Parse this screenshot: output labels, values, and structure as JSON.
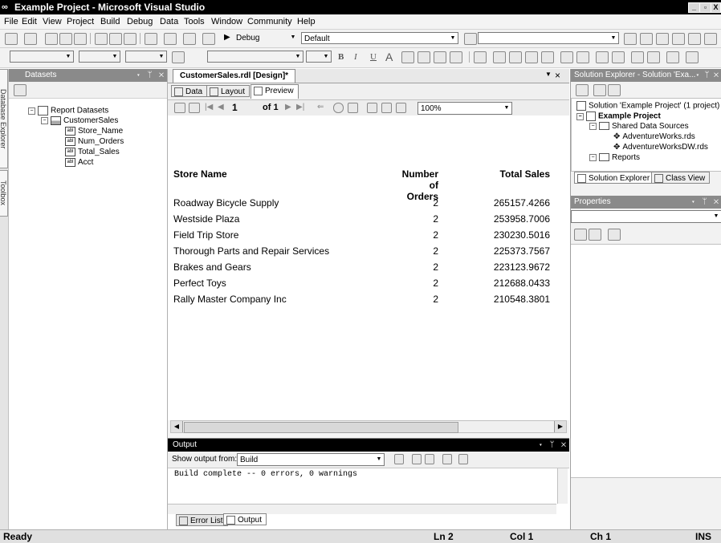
{
  "window": {
    "title": "Example Project - Microsoft Visual Studio",
    "min": "_",
    "max": "▫",
    "close": "X"
  },
  "menu": [
    "File",
    "Edit",
    "View",
    "Project",
    "Build",
    "Debug",
    "Data",
    "Tools",
    "Window",
    "Community",
    "Help"
  ],
  "toolbar": {
    "config": "Debug",
    "platform": "Default"
  },
  "left_tabs": {
    "db_explorer": "Database Explorer",
    "toolbox": "Toolbox"
  },
  "datasets": {
    "title": "Datasets",
    "root": "Report Datasets",
    "dataset": "CustomerSales",
    "fields": [
      "Store_Name",
      "Num_Orders",
      "Total_Sales",
      "Acct"
    ],
    "field_badge": "abl"
  },
  "doc": {
    "tab": "CustomerSales.rdl [Design]*",
    "close": "×",
    "subtabs": [
      "Data",
      "Layout",
      "Preview"
    ],
    "preview_toolbar": {
      "page": "1",
      "of": "of 1",
      "zoom": "100%"
    }
  },
  "report": {
    "headers": {
      "store": "Store Name",
      "orders_1": "Number of",
      "orders_2": "Orders",
      "sales": "Total Sales"
    },
    "rows": [
      {
        "store": "Roadway Bicycle Supply",
        "orders": "2",
        "sales": "265157.4266"
      },
      {
        "store": "Westside Plaza",
        "orders": "2",
        "sales": "253958.7006"
      },
      {
        "store": "Field Trip Store",
        "orders": "2",
        "sales": "230230.5016"
      },
      {
        "store": "Thorough Parts and Repair Services",
        "orders": "2",
        "sales": "225373.7567"
      },
      {
        "store": "Brakes and Gears",
        "orders": "2",
        "sales": "223123.9672"
      },
      {
        "store": "Perfect Toys",
        "orders": "2",
        "sales": "212688.0433"
      },
      {
        "store": "Rally Master Company Inc",
        "orders": "2",
        "sales": "210548.3801"
      }
    ]
  },
  "output": {
    "title": "Output",
    "show_label": "Show output from:",
    "source": "Build",
    "text": "Build complete -- 0 errors, 0 warnings",
    "tabs": [
      "Error List",
      "Output"
    ]
  },
  "solution_explorer": {
    "title": "Solution Explorer - Solution 'Exa...",
    "solution": "Solution 'Example Project' (1 project)",
    "project": "Example Project",
    "shared": "Shared Data Sources",
    "sources": [
      "AdventureWorks.rds",
      "AdventureWorksDW.rds"
    ],
    "reports": "Reports",
    "tabs": [
      "Solution Explorer",
      "Class View"
    ]
  },
  "properties": {
    "title": "Properties"
  },
  "status": {
    "ready": "Ready",
    "ln": "Ln 2",
    "col": "Col 1",
    "ch": "Ch 1",
    "ins": "INS"
  }
}
